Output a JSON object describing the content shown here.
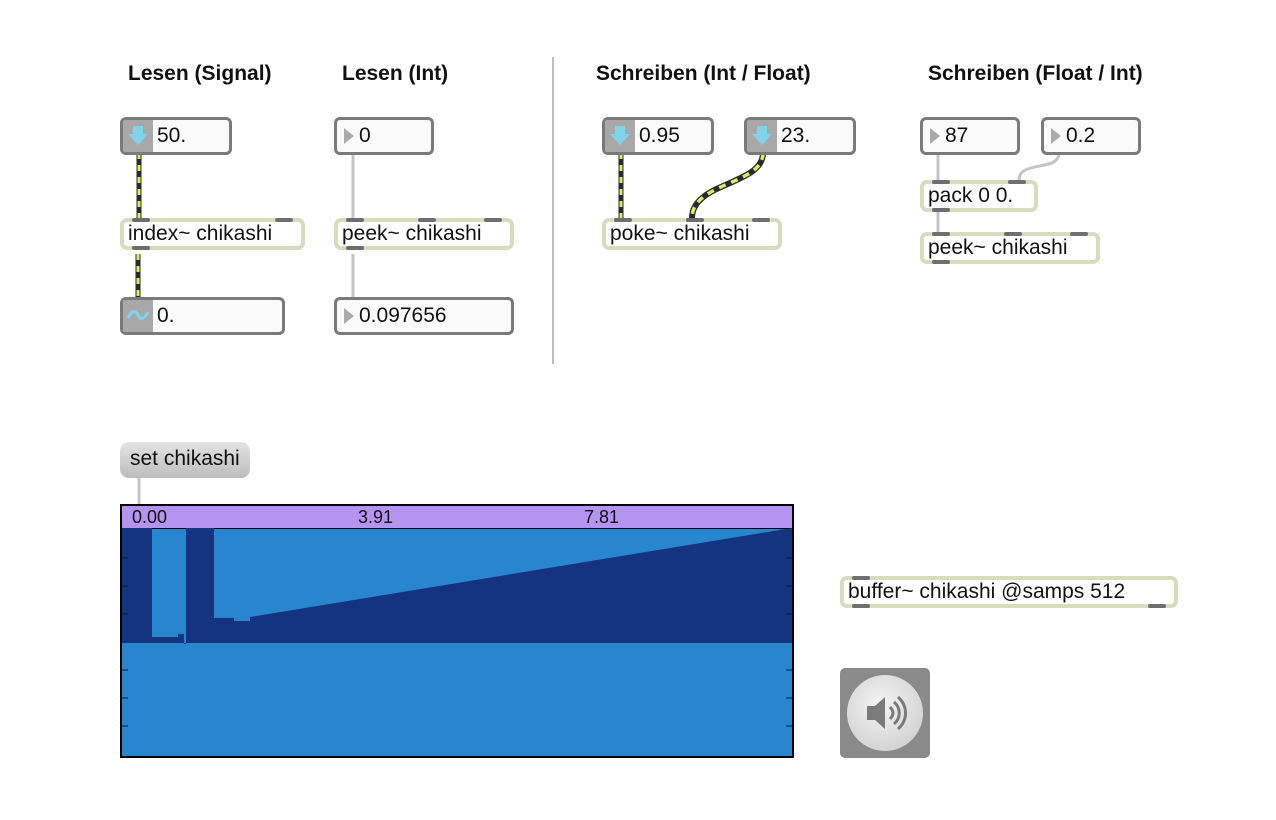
{
  "headings": {
    "read_signal": "Lesen (Signal)",
    "read_int": "Lesen (Int)",
    "write_int_float": "Schreiben (Int / Float)",
    "write_float_int": "Schreiben (Float / Int)"
  },
  "numbers": {
    "index_in": "50.",
    "index_out": "0.",
    "peek_in": "0",
    "peek_out": "0.097656",
    "poke_value": "0.95",
    "poke_index": "23.",
    "pack_left": "87",
    "pack_right": "0.2"
  },
  "objects": {
    "index": "index~ chikashi",
    "peek1": "peek~ chikashi",
    "poke": "poke~ chikashi",
    "pack": "pack 0 0.",
    "peek2": "peek~ chikashi",
    "buffer": "buffer~ chikashi @samps 512"
  },
  "message": {
    "set": "set chikashi"
  },
  "waveform": {
    "ruler": [
      "0.00",
      "3.91",
      "7.81"
    ],
    "colors": {
      "ruler": "#b493f1",
      "background": "#2886d0",
      "wave": "#143480"
    }
  },
  "icons": {
    "number_signal": "down-arrow-icon",
    "signal_output": "tilde-icon",
    "int_number": "triangle-icon",
    "dac": "speaker-icon"
  }
}
